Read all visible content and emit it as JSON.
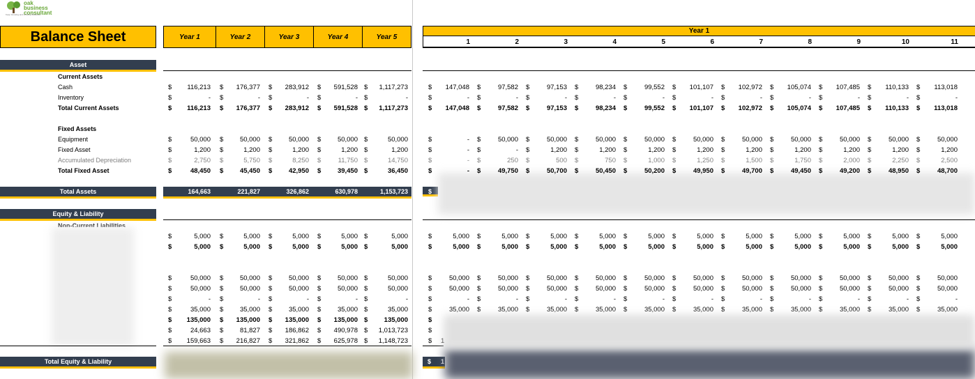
{
  "logo": {
    "name": "oak business consultant",
    "tagline": "Keep Growing and Growing Business"
  },
  "title": "Balance Sheet",
  "year_headers": [
    "Year 1",
    "Year 2",
    "Year 3",
    "Year 4",
    "Year 5"
  ],
  "right_year_label": "Year 1",
  "month_headers": [
    "1",
    "2",
    "3",
    "4",
    "5",
    "6",
    "7",
    "8",
    "9",
    "10",
    "11"
  ],
  "sections": {
    "asset": "Asset",
    "current_assets": "Current Assets",
    "fixed_assets": "Fixed Assets",
    "total_assets": "Total Assets",
    "equity_liability": "Equity & Liability",
    "non_current_liabilities": "Non-Current Liabilities",
    "total_equity_liability": "Total Equity & Liability"
  },
  "currency": "$",
  "rows": [
    {
      "label": "Cash",
      "style": "normal",
      "years": [
        "116,213",
        "176,377",
        "283,912",
        "591,528",
        "1,117,273"
      ],
      "months": [
        "147,048",
        "97,582",
        "97,153",
        "98,234",
        "99,552",
        "101,107",
        "102,972",
        "105,074",
        "107,485",
        "110,133",
        "113,018"
      ]
    },
    {
      "label": "Inventory",
      "style": "normal",
      "years": [
        "-",
        "-",
        "-",
        "-",
        "-"
      ],
      "months": [
        "-",
        "-",
        "-",
        "-",
        "-",
        "-",
        "-",
        "-",
        "-",
        "-",
        "-"
      ]
    },
    {
      "label": "Total Current Assets",
      "style": "bold",
      "years": [
        "116,213",
        "176,377",
        "283,912",
        "591,528",
        "1,117,273"
      ],
      "months": [
        "147,048",
        "97,582",
        "97,153",
        "98,234",
        "99,552",
        "101,107",
        "102,972",
        "105,074",
        "107,485",
        "110,133",
        "113,018"
      ]
    },
    {
      "label": "Equipment",
      "style": "normal",
      "years": [
        "50,000",
        "50,000",
        "50,000",
        "50,000",
        "50,000"
      ],
      "months": [
        "-",
        "50,000",
        "50,000",
        "50,000",
        "50,000",
        "50,000",
        "50,000",
        "50,000",
        "50,000",
        "50,000",
        "50,000"
      ]
    },
    {
      "label": "Fixed Asset",
      "style": "normal",
      "years": [
        "1,200",
        "1,200",
        "1,200",
        "1,200",
        "1,200"
      ],
      "months": [
        "-",
        "-",
        "1,200",
        "1,200",
        "1,200",
        "1,200",
        "1,200",
        "1,200",
        "1,200",
        "1,200",
        "1,200"
      ]
    },
    {
      "label": "Accumulated Depreciation",
      "style": "grey",
      "years": [
        "2,750",
        "5,750",
        "8,250",
        "11,750",
        "14,750"
      ],
      "months": [
        "-",
        "250",
        "500",
        "750",
        "1,000",
        "1,250",
        "1,500",
        "1,750",
        "2,000",
        "2,250",
        "2,500"
      ]
    },
    {
      "label": "Total Fixed Asset",
      "style": "bold",
      "years": [
        "48,450",
        "45,450",
        "42,950",
        "39,450",
        "36,450"
      ],
      "months": [
        "-",
        "49,750",
        "50,700",
        "50,450",
        "50,200",
        "49,950",
        "49,700",
        "49,450",
        "49,200",
        "48,950",
        "48,700"
      ]
    },
    {
      "label": "",
      "style": "normal",
      "years": [
        "5,000",
        "5,000",
        "5,000",
        "5,000",
        "5,000"
      ],
      "months": [
        "5,000",
        "5,000",
        "5,000",
        "5,000",
        "5,000",
        "5,000",
        "5,000",
        "5,000",
        "5,000",
        "5,000",
        "5,000"
      ]
    },
    {
      "label": "",
      "style": "bold",
      "years": [
        "5,000",
        "5,000",
        "5,000",
        "5,000",
        "5,000"
      ],
      "months": [
        "5,000",
        "5,000",
        "5,000",
        "5,000",
        "5,000",
        "5,000",
        "5,000",
        "5,000",
        "5,000",
        "5,000",
        "5,000"
      ]
    },
    {
      "label": "",
      "style": "normal",
      "years": [
        "50,000",
        "50,000",
        "50,000",
        "50,000",
        "50,000"
      ],
      "months": [
        "50,000",
        "50,000",
        "50,000",
        "50,000",
        "50,000",
        "50,000",
        "50,000",
        "50,000",
        "50,000",
        "50,000",
        "50,000"
      ]
    },
    {
      "label": "",
      "style": "normal",
      "years": [
        "50,000",
        "50,000",
        "50,000",
        "50,000",
        "50,000"
      ],
      "months": [
        "50,000",
        "50,000",
        "50,000",
        "50,000",
        "50,000",
        "50,000",
        "50,000",
        "50,000",
        "50,000",
        "50,000",
        "50,000"
      ]
    },
    {
      "label": "",
      "style": "normal",
      "years": [
        "-",
        "-",
        "-",
        "-",
        "-"
      ],
      "months": [
        "-",
        "-",
        "-",
        "-",
        "-",
        "-",
        "-",
        "-",
        "-",
        "-",
        "-"
      ]
    },
    {
      "label": "",
      "style": "normal",
      "years": [
        "35,000",
        "35,000",
        "35,000",
        "35,000",
        "35,000"
      ],
      "months": [
        "35,000",
        "35,000",
        "35,000",
        "35,000",
        "35,000",
        "35,000",
        "35,000",
        "35,000",
        "35,000",
        "35,000",
        "35,000"
      ]
    },
    {
      "label": "",
      "style": "bold",
      "years": [
        "135,000",
        "135,000",
        "135,000",
        "135,000",
        "135,000"
      ],
      "months": []
    },
    {
      "label": "",
      "style": "normal",
      "years": [
        "24,663",
        "81,827",
        "186,862",
        "490,978",
        "1,013,723"
      ],
      "months": []
    },
    {
      "label": "",
      "style": "normal",
      "years": [
        "159,663",
        "216,827",
        "321,862",
        "625,978",
        "1,148,723"
      ],
      "months": [
        "1"
      ]
    }
  ],
  "total_assets_years": [
    "164,663",
    "221,827",
    "326,862",
    "630,978",
    "1,153,723"
  ],
  "total_equity_right_prefix": "1"
}
